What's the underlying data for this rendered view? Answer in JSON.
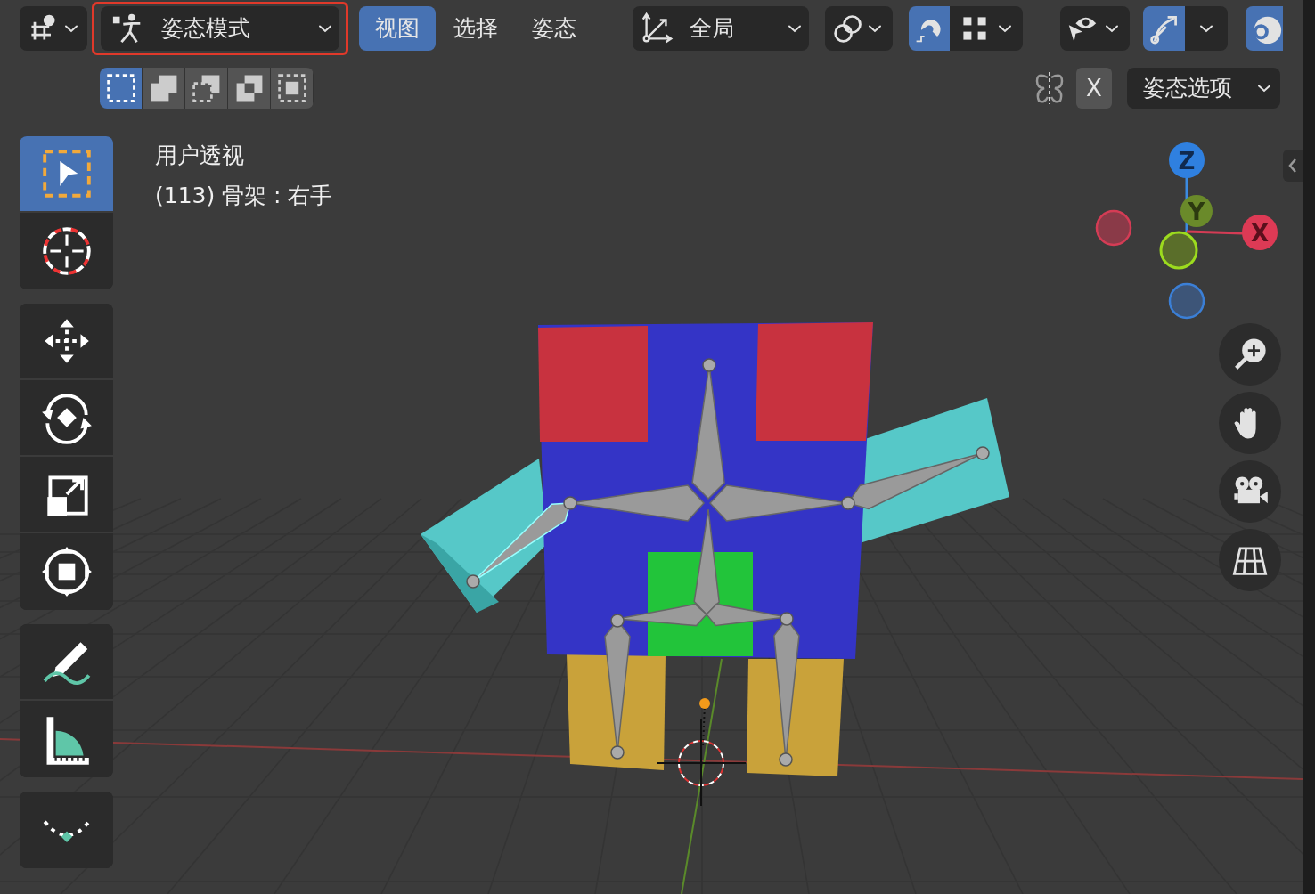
{
  "header": {
    "mode_dropdown": {
      "label": "姿态模式",
      "highlighted": true
    },
    "menus": [
      {
        "label": "视图",
        "selected": true
      },
      {
        "label": "选择",
        "selected": false
      },
      {
        "label": "姿态",
        "selected": false
      }
    ],
    "orientation_dropdown": {
      "label": "全局"
    },
    "snap_toggle": {
      "on": true
    },
    "overlay_toggle": {
      "on": true
    }
  },
  "select_modes": [
    {
      "kind": "new",
      "selected": true
    },
    {
      "kind": "extend",
      "selected": false
    },
    {
      "kind": "subtract",
      "selected": false
    },
    {
      "kind": "invert",
      "selected": false
    },
    {
      "kind": "intersect",
      "selected": false
    }
  ],
  "mirror_x": {
    "label": "X",
    "on": false
  },
  "options_dropdown": {
    "label": "姿态选项"
  },
  "viewport_info": [
    "用户透视",
    "(113) 骨架 : 右手"
  ],
  "tool_groups": [
    [
      {
        "kind": "select",
        "selected": true
      },
      {
        "kind": "cursor",
        "selected": false
      }
    ],
    [
      {
        "kind": "move",
        "selected": false
      },
      {
        "kind": "rotate",
        "selected": false
      },
      {
        "kind": "scale",
        "selected": false
      },
      {
        "kind": "transform",
        "selected": false
      }
    ],
    [
      {
        "kind": "annotate",
        "selected": false
      },
      {
        "kind": "measure",
        "selected": false
      }
    ],
    [
      {
        "kind": "curve",
        "selected": false
      }
    ]
  ],
  "axis_gizmo": {
    "labels": [
      "Z",
      "Y",
      "X"
    ]
  }
}
